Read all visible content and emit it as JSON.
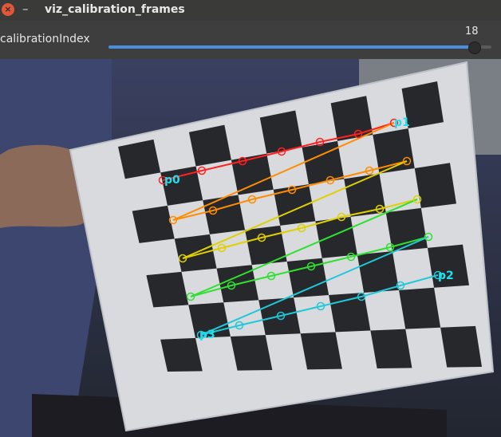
{
  "window": {
    "title": "viz_calibration_frames",
    "close_glyph": "×",
    "minimize_glyph": "–"
  },
  "trackbar": {
    "label": "calibrationIndex",
    "value": "18",
    "fraction": 0.955,
    "accent_color": "#4a8fdb"
  },
  "view": {
    "corner_labels": [
      "p0",
      "p1",
      "p2",
      "p3"
    ],
    "row_colors": [
      "#ff2020",
      "#ff8c00",
      "#e0d000",
      "#30e030",
      "#20c8d8"
    ],
    "label_color": "#20e0f0"
  }
}
